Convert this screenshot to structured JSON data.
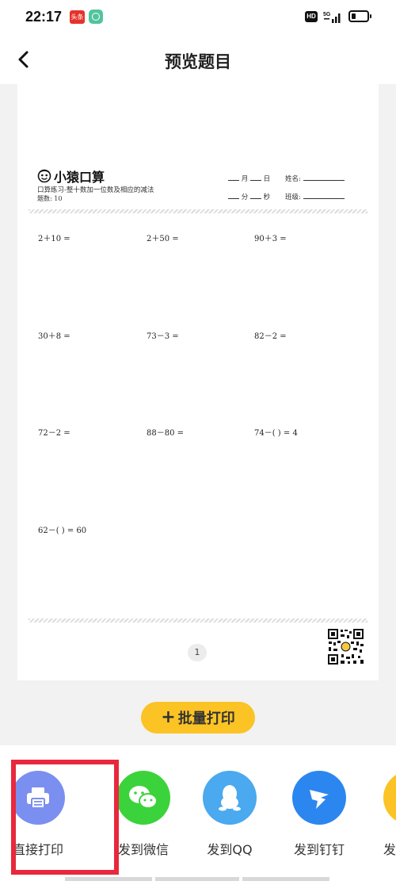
{
  "status_bar": {
    "time": "22:17",
    "app1_label": "头条",
    "hd_label": "HD",
    "network": "5G"
  },
  "nav": {
    "title": "预览题目"
  },
  "sheet": {
    "logo_text": "小猿口算",
    "subtitle": "口算练习-整十数加一位数及相应的减法",
    "count_label": "题数: 10",
    "month_label": "月",
    "day_label": "日",
    "minute_label": "分",
    "second_label": "秒",
    "name_label": "姓名:",
    "class_label": "班级:",
    "problems": [
      "2＋10 =",
      "2＋50 =",
      "90＋3 =",
      "30＋8 =",
      "73－3 =",
      "82－2 =",
      "72－2 =",
      "88－80 =",
      "74－(    ) = 4",
      "62－(    ) = 60"
    ],
    "page_number": "1"
  },
  "batch_print": {
    "label": "批量打印"
  },
  "share": {
    "items": [
      {
        "label": "直接打印",
        "color": "#7b8ff0"
      },
      {
        "label": "发到微信",
        "color": "#3bd33b"
      },
      {
        "label": "发到QQ",
        "color": "#4aa9ef"
      },
      {
        "label": "发到钉钉",
        "color": "#2c86ef"
      },
      {
        "label": "发",
        "color": "#fbc324"
      }
    ]
  },
  "colors": {
    "accent_yellow": "#fbc324",
    "highlight_red": "#e8283c"
  }
}
